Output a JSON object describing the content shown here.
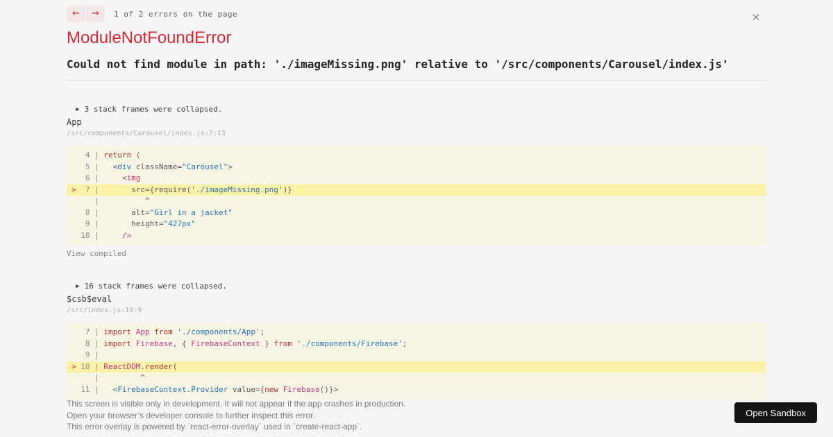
{
  "colors": {
    "accent_red": "#cf2b36",
    "code_bg": "#f6f4e2",
    "code_hl_bg": "#fbf2a7",
    "tok_keyword": "#ab352e",
    "tok_string": "#2973b7",
    "tok_tag": "#2973b7",
    "tok_class": "#bf3a83",
    "tok_plain": "#565c64",
    "page_bg": "#f5f5f5",
    "btn_bg": "#151515"
  },
  "overlay": {
    "nav": {
      "prev_label": "←",
      "next_label": "→",
      "counter": "1 of 2 errors on the page"
    },
    "close_label": "×",
    "title": "ModuleNotFoundError",
    "message": "Could not find module in path: './imageMissing.png' relative to '/src/components/Carousel/index.js'",
    "frames": [
      {
        "collapse_marker": "▶",
        "collapsed_text": "3 stack frames were collapsed.",
        "function_name": "App",
        "location": "/src/components/Carousel/index.js:7:13",
        "view_link": "View compiled",
        "code": [
          {
            "mark": " ",
            "num": " 4",
            "hl": false,
            "tokens": [
              [
                "k",
                "return"
              ],
              [
                "p",
                " ("
              ]
            ]
          },
          {
            "mark": " ",
            "num": " 5",
            "hl": false,
            "tokens": [
              [
                "p",
                "  <"
              ],
              [
                "t",
                "div"
              ],
              [
                "p",
                " className="
              ],
              [
                "s",
                "\"Carousel\""
              ],
              [
                "p",
                ">"
              ]
            ]
          },
          {
            "mark": " ",
            "num": " 6",
            "hl": false,
            "tokens": [
              [
                "p",
                "    <"
              ],
              [
                "c",
                "img"
              ]
            ]
          },
          {
            "mark": ">",
            "num": " 7",
            "hl": true,
            "tokens": [
              [
                "p",
                "      src={require("
              ],
              [
                "s",
                "'./imageMissing.png'"
              ],
              [
                "p",
                ")}"
              ]
            ]
          },
          {
            "mark": " ",
            "num": "  ",
            "hl": false,
            "tokens": [
              [
                "r",
                "         ^"
              ]
            ]
          },
          {
            "mark": " ",
            "num": " 8",
            "hl": false,
            "tokens": [
              [
                "p",
                "      alt="
              ],
              [
                "s",
                "\"Girl in a jacket\""
              ]
            ]
          },
          {
            "mark": " ",
            "num": " 9",
            "hl": false,
            "tokens": [
              [
                "p",
                "      height="
              ],
              [
                "s",
                "\"427px\""
              ]
            ]
          },
          {
            "mark": " ",
            "num": "10",
            "hl": false,
            "tokens": [
              [
                "p",
                "    "
              ],
              [
                "c",
                "/>"
              ]
            ]
          }
        ]
      },
      {
        "collapse_marker": "▶",
        "collapsed_text": "16 stack frames were collapsed.",
        "function_name": "$csb$eval",
        "location": "/src/index.js:10:9",
        "code": [
          {
            "mark": " ",
            "num": " 7",
            "hl": false,
            "tokens": [
              [
                "k",
                "import"
              ],
              [
                "p",
                " "
              ],
              [
                "c",
                "App"
              ],
              [
                "p",
                " "
              ],
              [
                "k",
                "from"
              ],
              [
                "p",
                " "
              ],
              [
                "s",
                "'./components/App'"
              ],
              [
                "p",
                ";"
              ]
            ]
          },
          {
            "mark": " ",
            "num": " 8",
            "hl": false,
            "tokens": [
              [
                "k",
                "import"
              ],
              [
                "p",
                " "
              ],
              [
                "c",
                "Firebase"
              ],
              [
                "p",
                ", { "
              ],
              [
                "c",
                "FirebaseContext"
              ],
              [
                "p",
                " } "
              ],
              [
                "k",
                "from"
              ],
              [
                "p",
                " "
              ],
              [
                "s",
                "'./components/Firebase'"
              ],
              [
                "p",
                ";"
              ]
            ]
          },
          {
            "mark": " ",
            "num": " 9",
            "hl": false,
            "tokens": []
          },
          {
            "mark": ">",
            "num": "10",
            "hl": true,
            "tokens": [
              [
                "c",
                "ReactDOM"
              ],
              [
                "p",
                "."
              ],
              [
                "k",
                "render"
              ],
              [
                "p",
                "("
              ]
            ]
          },
          {
            "mark": " ",
            "num": "  ",
            "hl": false,
            "tokens": [
              [
                "r",
                "        ^"
              ]
            ]
          },
          {
            "mark": " ",
            "num": "11",
            "hl": false,
            "tokens": [
              [
                "p",
                "  <"
              ],
              [
                "t",
                "FirebaseContext.Provider"
              ],
              [
                "p",
                " value={"
              ],
              [
                "k",
                "new"
              ],
              [
                "p",
                " "
              ],
              [
                "c",
                "Firebase"
              ],
              [
                "p",
                "()}>"
              ]
            ]
          }
        ]
      }
    ],
    "footer_lines": [
      "This screen is visible only in development. It will not appear if the app crashes in production.",
      "Open your browser’s developer console to further inspect this error.",
      "This error overlay is powered by `react-error-overlay` used in `create-react-app`."
    ],
    "open_sandbox_label": "Open Sandbox"
  }
}
